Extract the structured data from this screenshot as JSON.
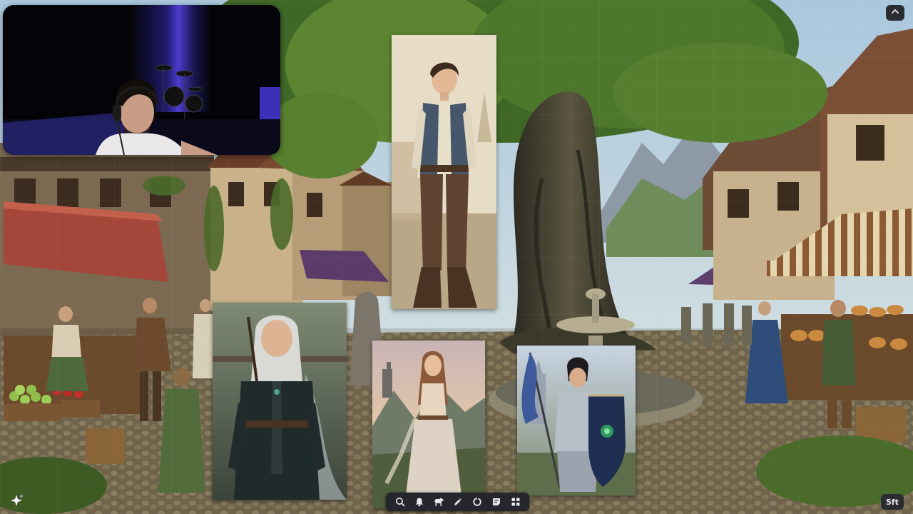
{
  "app": {
    "distance_badge": "5ft"
  },
  "toolbar": {
    "tools": [
      {
        "icon": "search-icon"
      },
      {
        "icon": "bell-icon"
      },
      {
        "icon": "horse-icon"
      },
      {
        "icon": "pencil-icon"
      },
      {
        "icon": "circle-refresh-icon"
      },
      {
        "icon": "note-icon"
      },
      {
        "icon": "grid-apps-icon"
      }
    ]
  },
  "controls": {
    "ai_icon": "sparkle-icon",
    "collapse_icon": "chevron-up-icon"
  },
  "scene": {
    "type": "medieval village market backdrop"
  },
  "cards": [
    {
      "name": "peasant-boy-portrait"
    },
    {
      "name": "silver-haired-ranger-portrait"
    },
    {
      "name": "elven-woman-portrait"
    },
    {
      "name": "armored-knight-portrait"
    }
  ],
  "colors": {
    "toolbar_bg": "#24262c",
    "icon_color": "#e9eaee",
    "ai_accent": "#c6a8ff"
  }
}
